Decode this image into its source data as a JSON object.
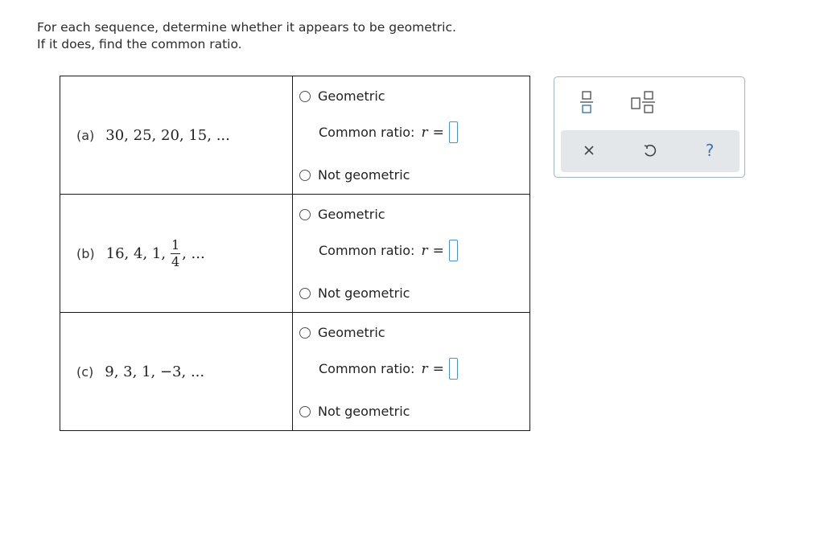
{
  "instructions": {
    "line1": "For each sequence, determine whether it appears to be geometric.",
    "line2": "If it does, find the common ratio."
  },
  "problems": [
    {
      "label": "(a)",
      "sequence_text": "30, 25, 20, 15, ...",
      "option_geometric": "Geometric",
      "ratio_label": "Common ratio:",
      "ratio_var": "r",
      "ratio_eq": "=",
      "ratio_value": "",
      "option_not": "Not geometric"
    },
    {
      "label": "(b)",
      "sequence_prefix": "16, 4, 1,",
      "fraction_num": "1",
      "fraction_den": "4",
      "sequence_suffix": ", ...",
      "option_geometric": "Geometric",
      "ratio_label": "Common ratio:",
      "ratio_var": "r",
      "ratio_eq": "=",
      "ratio_value": "",
      "option_not": "Not geometric"
    },
    {
      "label": "(c)",
      "sequence_text": "9, 3, 1, −3, ...",
      "option_geometric": "Geometric",
      "ratio_label": "Common ratio:",
      "ratio_var": "r",
      "ratio_eq": "=",
      "ratio_value": "",
      "option_not": "Not geometric"
    }
  ],
  "toolbox": {
    "icons": [
      "fraction-icon",
      "mixed-number-icon",
      "clear-icon",
      "undo-icon",
      "help-icon"
    ],
    "help_glyph": "?",
    "accent_color": "#3b74b8",
    "input_border_color": "#4a90d9"
  }
}
